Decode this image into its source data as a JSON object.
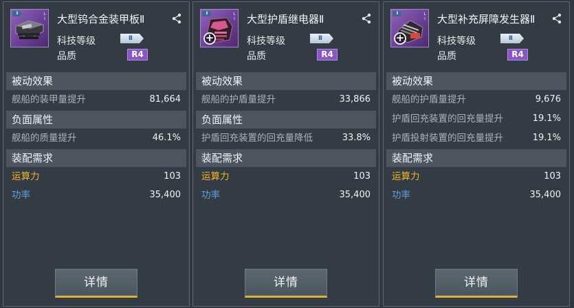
{
  "cards": [
    {
      "name": "大型钨合金装甲板Ⅱ",
      "tier_badge": "Ⅱ",
      "side_mark": "L\nI",
      "tech_level_label": "科技等级",
      "tech_level_badge": "Ⅱ",
      "quality_label": "品质",
      "quality_badge": "R4",
      "passive_title": "被动效果",
      "passive_rows": [
        {
          "label": "舰船的装甲量提升",
          "value": "81,664"
        }
      ],
      "negative_title": "负面属性",
      "negative_rows": [
        {
          "label": "舰船的质量提升",
          "value": "46.1%"
        }
      ],
      "req_title": "装配需求",
      "req_calc_label": "运算力",
      "req_calc_value": "103",
      "req_power_label": "功率",
      "req_power_value": "35,400",
      "detail_label": "详情",
      "icon": "armor-plate-icon"
    },
    {
      "name": "大型护盾继电器Ⅱ",
      "tier_badge": "Ⅱ",
      "side_mark": "L\nI",
      "tech_level_label": "科技等级",
      "tech_level_badge": "Ⅱ",
      "quality_label": "品质",
      "quality_badge": "R4",
      "passive_title": "被动效果",
      "passive_rows": [
        {
          "label": "舰船的护盾量提升",
          "value": "33,866"
        }
      ],
      "negative_title": "负面属性",
      "negative_rows": [
        {
          "label": "护盾回充装置的回充量降低",
          "value": "33.8%"
        }
      ],
      "req_title": "装配需求",
      "req_calc_label": "运算力",
      "req_calc_value": "103",
      "req_power_label": "功率",
      "req_power_value": "35,400",
      "detail_label": "详情",
      "icon": "shield-relay-icon"
    },
    {
      "name": "大型补充屏障发生器Ⅱ",
      "tier_badge": "Ⅱ",
      "side_mark": "L\nI",
      "tech_level_label": "科技等级",
      "tech_level_badge": "Ⅱ",
      "quality_label": "品质",
      "quality_badge": "R4",
      "passive_title": "被动效果",
      "passive_rows": [
        {
          "label": "舰船的护盾量提升",
          "value": "9,676"
        },
        {
          "label": "护盾回充装置的回充量提升",
          "value": "19.1%"
        },
        {
          "label": "护盾投射装置的回充量提升",
          "value": "19.1%"
        }
      ],
      "req_title": "装配需求",
      "req_calc_label": "运算力",
      "req_calc_value": "103",
      "req_power_label": "功率",
      "req_power_value": "35,400",
      "detail_label": "详情",
      "icon": "barrier-generator-icon"
    }
  ],
  "colors": {
    "calc_label": "#f0b429",
    "power_label": "#5fa2dc",
    "rank_badge": "#8a55c4",
    "button_underline": "#e2b130"
  }
}
